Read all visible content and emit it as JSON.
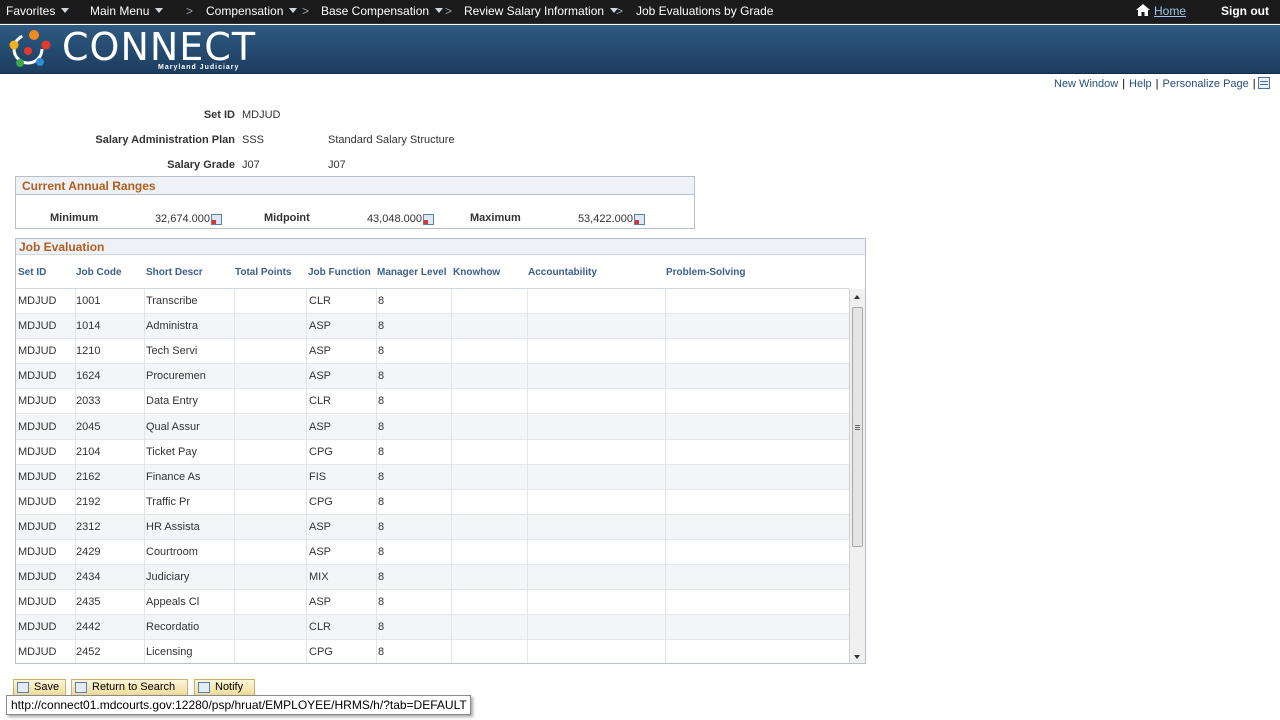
{
  "topnav": {
    "favorites": "Favorites",
    "main_menu": "Main Menu",
    "compensation": "Compensation",
    "base_compensation": "Base Compensation",
    "review_salary": "Review Salary Information",
    "current_page": "Job Evaluations by Grade",
    "separator": ">",
    "home": "Home",
    "signout": "Sign out"
  },
  "banner": {
    "logo_text": "CONNECT",
    "logo_sub": "Maryland Judiciary"
  },
  "utility": {
    "new_window": "New Window",
    "help": "Help",
    "personalize": "Personalize Page",
    "bar": "|"
  },
  "fields": {
    "setid_label": "Set ID",
    "setid_value": "MDJUD",
    "plan_label": "Salary Administration Plan",
    "plan_value": "SSS",
    "plan_desc": "Standard Salary Structure",
    "grade_label": "Salary Grade",
    "grade_value": "J07",
    "grade_desc": "J07"
  },
  "ranges": {
    "title": "Current Annual Ranges",
    "min_label": "Minimum",
    "min_value": "32,674.000",
    "mid_label": "Midpoint",
    "mid_value": "43,048.000",
    "max_label": "Maximum",
    "max_value": "53,422.000"
  },
  "job_evaluation": {
    "title": "Job Evaluation",
    "columns": [
      "Set ID",
      "Job Code",
      "Short Descr",
      "Total Points",
      "Job Function",
      "Manager Level",
      "Knowhow",
      "Accountability",
      "Problem-Solving"
    ],
    "rows": [
      [
        "MDJUD",
        "1001",
        "Transcribe",
        "",
        "CLR",
        "8"
      ],
      [
        "MDJUD",
        "1014",
        "Administra",
        "",
        "ASP",
        "8"
      ],
      [
        "MDJUD",
        "1210",
        "Tech Servi",
        "",
        "ASP",
        "8"
      ],
      [
        "MDJUD",
        "1624",
        "Procuremen",
        "",
        "ASP",
        "8"
      ],
      [
        "MDJUD",
        "2033",
        "Data Entry",
        "",
        "CLR",
        "8"
      ],
      [
        "MDJUD",
        "2045",
        "Qual Assur",
        "",
        "ASP",
        "8"
      ],
      [
        "MDJUD",
        "2104",
        "Ticket Pay",
        "",
        "CPG",
        "8"
      ],
      [
        "MDJUD",
        "2162",
        "Finance As",
        "",
        "FIS",
        "8"
      ],
      [
        "MDJUD",
        "2192",
        "Traffic Pr",
        "",
        "CPG",
        "8"
      ],
      [
        "MDJUD",
        "2312",
        "HR Assista",
        "",
        "ASP",
        "8"
      ],
      [
        "MDJUD",
        "2429",
        "Courtroom",
        "",
        "ASP",
        "8"
      ],
      [
        "MDJUD",
        "2434",
        "Judiciary",
        "",
        "MIX",
        "8"
      ],
      [
        "MDJUD",
        "2435",
        "Appeals Cl",
        "",
        "ASP",
        "8"
      ],
      [
        "MDJUD",
        "2442",
        "Recordatio",
        "",
        "CLR",
        "8"
      ],
      [
        "MDJUD",
        "2452",
        "Licensing",
        "",
        "CPG",
        "8"
      ]
    ]
  },
  "buttons": {
    "save": "Save",
    "return": "Return to Search",
    "notify": "Notify"
  },
  "status_url": "http://connect01.mdcourts.gov:12280/psp/hruat/EMPLOYEE/HRMS/h/?tab=DEFAULT"
}
